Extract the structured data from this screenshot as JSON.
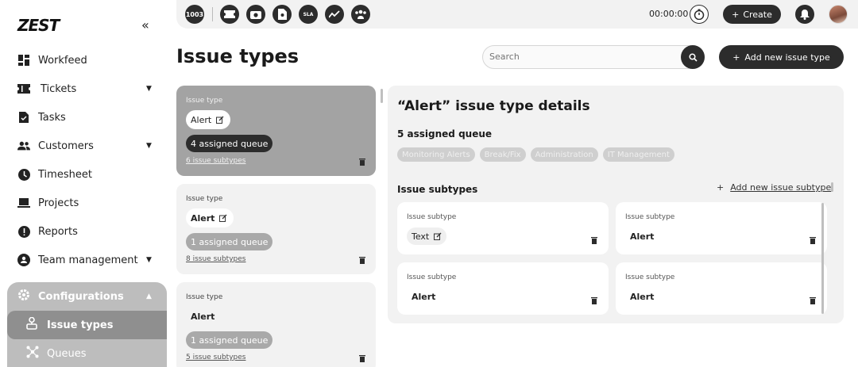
{
  "app": {
    "logo": "ZEST"
  },
  "sidebar": {
    "collapse_icon": "double-chevron-left-icon",
    "items": [
      {
        "label": "Workfeed",
        "icon": "dashboard-icon",
        "has_caret": false
      },
      {
        "label": "Tickets",
        "icon": "ticket-icon",
        "has_caret": true
      },
      {
        "label": "Tasks",
        "icon": "task-icon",
        "has_caret": false
      },
      {
        "label": "Customers",
        "icon": "people-icon",
        "has_caret": true
      },
      {
        "label": "Timesheet",
        "icon": "clock-icon",
        "has_caret": false
      },
      {
        "label": "Projects",
        "icon": "laptop-icon",
        "has_caret": false
      },
      {
        "label": "Reports",
        "icon": "alert-circle-icon",
        "has_caret": false
      },
      {
        "label": "Team management",
        "icon": "team-icon",
        "has_caret": true
      }
    ],
    "config": {
      "label": "Configurations",
      "icon": "gear-icon",
      "subitems": [
        {
          "label": "Issue types",
          "icon": "issue-types-icon",
          "active": true
        },
        {
          "label": "Queues",
          "icon": "queues-icon",
          "active": false
        }
      ]
    }
  },
  "topbar": {
    "badge_count": "1003",
    "icons": [
      "ticket-icon",
      "camera-icon",
      "document-icon",
      "sla-icon",
      "trend-icon",
      "group-icon"
    ],
    "sla_label": "SLA",
    "timer": "00:00:00",
    "timer_icon": "stopwatch-icon",
    "create_label": "Create",
    "bell_icon": "bell-icon"
  },
  "header": {
    "title": "Issue types",
    "search_placeholder": "Search",
    "add_button_label": "Add new issue type"
  },
  "issue_types": [
    {
      "caption": "Issue type",
      "name": "Alert",
      "queue_label": "4 assigned queue",
      "subtypes_label": "6 issue subtypes",
      "selected": true,
      "editable": true
    },
    {
      "caption": "Issue type",
      "name": "Alert",
      "queue_label": "1 assigned queue",
      "subtypes_label": "8 issue subtypes",
      "selected": false,
      "editable": true
    },
    {
      "caption": "Issue type",
      "name": "Alert",
      "queue_label": "1 assigned queue",
      "subtypes_label": "5 issue subtypes",
      "selected": false,
      "editable": false
    }
  ],
  "details": {
    "title": "“Alert” issue type  details",
    "assigned_title": "5 assigned queue",
    "queues": [
      "Monitoring Alerts",
      "Break/Fix",
      "Administration",
      "IT Management"
    ],
    "subtypes_title": "Issue subtypes",
    "add_subtype_label": "Add new issue subtype",
    "subtypes": [
      {
        "caption": "Issue subtype",
        "name": "Text",
        "editable": true
      },
      {
        "caption": "Issue subtype",
        "name": "Alert",
        "editable": false
      },
      {
        "caption": "Issue subtype",
        "name": "Alert",
        "editable": false
      },
      {
        "caption": "Issue subtype",
        "name": "Alert",
        "editable": false
      }
    ]
  }
}
